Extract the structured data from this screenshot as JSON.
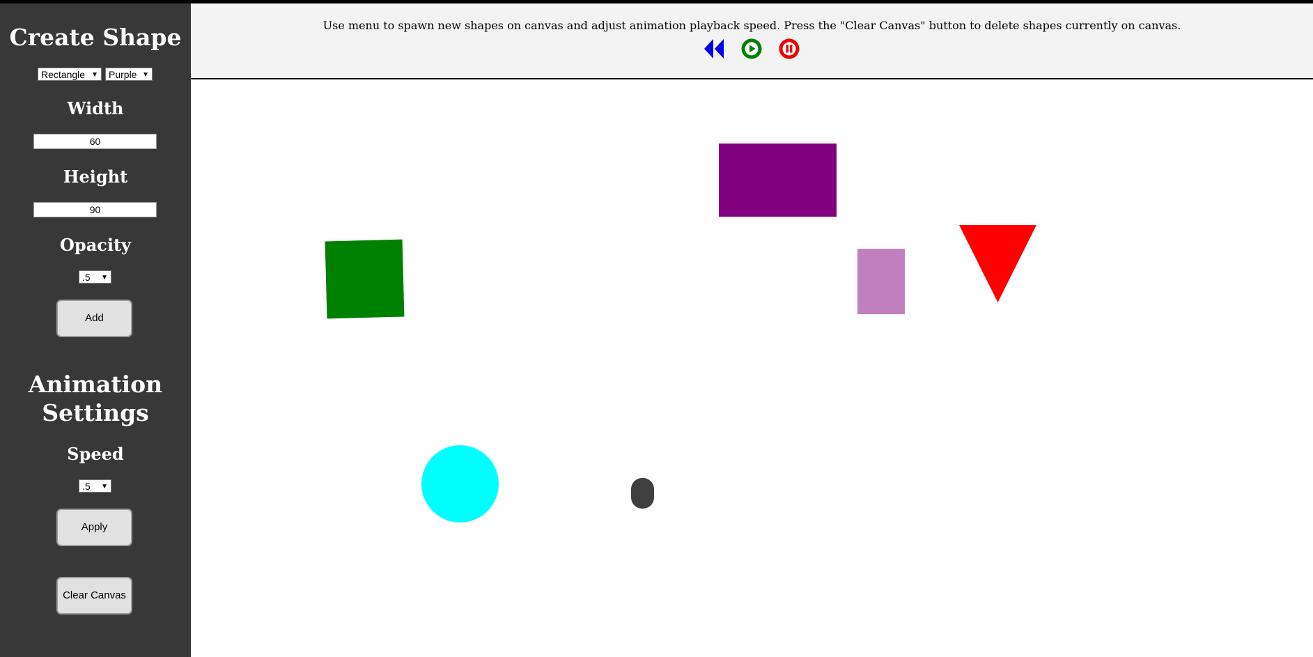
{
  "sidebar": {
    "create_title": "Create Shape",
    "shape_select": {
      "value": "Rectangle"
    },
    "color_select": {
      "value": "Purple"
    },
    "width_label": "Width",
    "width_value": "60",
    "height_label": "Height",
    "height_value": "90",
    "opacity_label": "Opacity",
    "opacity_select": {
      "value": ".5"
    },
    "add_label": "Add",
    "animation_title_line1": "Animation",
    "animation_title_line2": "Settings",
    "speed_label": "Speed",
    "speed_select": {
      "value": ".5"
    },
    "apply_label": "Apply",
    "clear_label": "Clear Canvas"
  },
  "header": {
    "instructions": "Use menu to spawn new shapes on canvas and adjust animation playback speed. Press the \"Clear Canvas\" button to delete shapes currently on canvas.",
    "controls": [
      {
        "icon": "rewind-icon",
        "color": "#0000ee"
      },
      {
        "icon": "play-icon",
        "color": "#008000"
      },
      {
        "icon": "pause-icon",
        "color": "#ee0000"
      }
    ]
  },
  "canvas": {
    "shapes": [
      {
        "kind": "rectangle",
        "color": "#800080"
      },
      {
        "kind": "rectangle",
        "color": "#008000"
      },
      {
        "kind": "rectangle",
        "color": "#c080c0"
      },
      {
        "kind": "triangle",
        "color": "#ff0000"
      },
      {
        "kind": "circle",
        "color": "#00ffff"
      },
      {
        "kind": "pill",
        "color": "#404040"
      }
    ]
  },
  "colors": {
    "sidebar_bg": "#383838",
    "header_bg": "#f3f3f3",
    "button_bg": "#e1e1e1"
  }
}
